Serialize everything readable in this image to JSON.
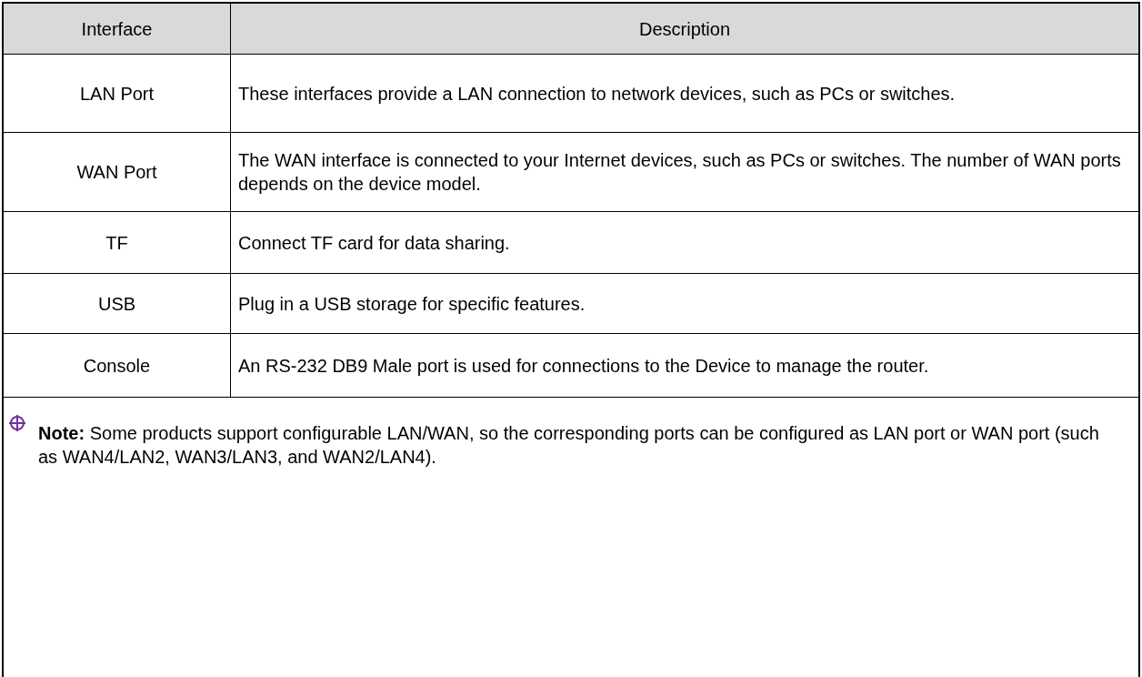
{
  "table": {
    "columns": [
      "Interface",
      "Description"
    ],
    "rows": [
      {
        "interface": "LAN Port",
        "description": "These interfaces provide a LAN connection to network devices, such as PCs or switches."
      },
      {
        "interface": "WAN Port",
        "description": "The WAN interface is connected to your Internet devices, such as PCs or switches. The number of WAN ports depends on the device model."
      },
      {
        "interface": "TF",
        "description": "Connect TF card for data sharing."
      },
      {
        "interface": "USB",
        "description": "Plug in a USB storage for specific features."
      },
      {
        "interface": "Console",
        "description": "An RS-232 DB9 Male port is used for connections to the Device to manage the router."
      }
    ],
    "note": "**Note:** Some products support configurable LAN/WAN, so the corresponding ports can be configured as LAN port or WAN port (such as WAN4/LAN2, WAN3/LAN3, and WAN2/LAN4)."
  }
}
